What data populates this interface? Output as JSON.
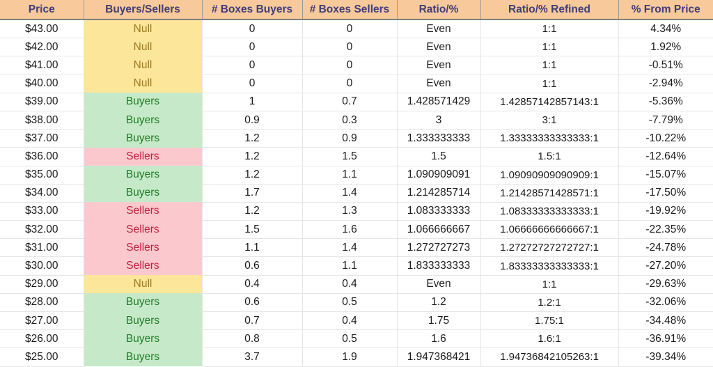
{
  "table": {
    "columns": [
      {
        "key": "price",
        "label": "Price"
      },
      {
        "key": "side",
        "label": "Buyers/Sellers"
      },
      {
        "key": "boxbuy",
        "label": "# Boxes Buyers"
      },
      {
        "key": "boxsell",
        "label": "# Boxes Sellers"
      },
      {
        "key": "ratio",
        "label": "Ratio/%"
      },
      {
        "key": "ratioref",
        "label": "Ratio/% Refined"
      },
      {
        "key": "frompx",
        "label": "% From Price"
      }
    ],
    "colors": {
      "header_bg": "#F8C99A",
      "header_text": "#3F3D7A",
      "null_bg": "#FCE69A",
      "null_text": "#9C7A1E",
      "buyers_bg": "#C6EAC9",
      "buyers_text": "#1E7B24",
      "sellers_bg": "#FBC8CE",
      "sellers_text": "#C0203C",
      "cell_bg": "#FFFFFF",
      "gridline": "#E6E6E6"
    },
    "rows": [
      {
        "price": "$43.00",
        "side": "Null",
        "boxbuy": "0",
        "boxsell": "0",
        "ratio": "Even",
        "ratioref": "1:1",
        "frompx": "4.34%"
      },
      {
        "price": "$42.00",
        "side": "Null",
        "boxbuy": "0",
        "boxsell": "0",
        "ratio": "Even",
        "ratioref": "1:1",
        "frompx": "1.92%"
      },
      {
        "price": "$41.00",
        "side": "Null",
        "boxbuy": "0",
        "boxsell": "0",
        "ratio": "Even",
        "ratioref": "1:1",
        "frompx": "-0.51%"
      },
      {
        "price": "$40.00",
        "side": "Null",
        "boxbuy": "0",
        "boxsell": "0",
        "ratio": "Even",
        "ratioref": "1:1",
        "frompx": "-2.94%"
      },
      {
        "price": "$39.00",
        "side": "Buyers",
        "boxbuy": "1",
        "boxsell": "0.7",
        "ratio": "1.428571429",
        "ratioref": "1.42857142857143:1",
        "frompx": "-5.36%"
      },
      {
        "price": "$38.00",
        "side": "Buyers",
        "boxbuy": "0.9",
        "boxsell": "0.3",
        "ratio": "3",
        "ratioref": "3:1",
        "frompx": "-7.79%"
      },
      {
        "price": "$37.00",
        "side": "Buyers",
        "boxbuy": "1.2",
        "boxsell": "0.9",
        "ratio": "1.333333333",
        "ratioref": "1.33333333333333:1",
        "frompx": "-10.22%"
      },
      {
        "price": "$36.00",
        "side": "Sellers",
        "boxbuy": "1.2",
        "boxsell": "1.5",
        "ratio": "1.5",
        "ratioref": "1.5:1",
        "frompx": "-12.64%"
      },
      {
        "price": "$35.00",
        "side": "Buyers",
        "boxbuy": "1.2",
        "boxsell": "1.1",
        "ratio": "1.090909091",
        "ratioref": "1.09090909090909:1",
        "frompx": "-15.07%"
      },
      {
        "price": "$34.00",
        "side": "Buyers",
        "boxbuy": "1.7",
        "boxsell": "1.4",
        "ratio": "1.214285714",
        "ratioref": "1.21428571428571:1",
        "frompx": "-17.50%"
      },
      {
        "price": "$33.00",
        "side": "Sellers",
        "boxbuy": "1.2",
        "boxsell": "1.3",
        "ratio": "1.083333333",
        "ratioref": "1.08333333333333:1",
        "frompx": "-19.92%"
      },
      {
        "price": "$32.00",
        "side": "Sellers",
        "boxbuy": "1.5",
        "boxsell": "1.6",
        "ratio": "1.066666667",
        "ratioref": "1.06666666666667:1",
        "frompx": "-22.35%"
      },
      {
        "price": "$31.00",
        "side": "Sellers",
        "boxbuy": "1.1",
        "boxsell": "1.4",
        "ratio": "1.272727273",
        "ratioref": "1.27272727272727:1",
        "frompx": "-24.78%"
      },
      {
        "price": "$30.00",
        "side": "Sellers",
        "boxbuy": "0.6",
        "boxsell": "1.1",
        "ratio": "1.833333333",
        "ratioref": "1.83333333333333:1",
        "frompx": "-27.20%"
      },
      {
        "price": "$29.00",
        "side": "Null",
        "boxbuy": "0.4",
        "boxsell": "0.4",
        "ratio": "Even",
        "ratioref": "1:1",
        "frompx": "-29.63%"
      },
      {
        "price": "$28.00",
        "side": "Buyers",
        "boxbuy": "0.6",
        "boxsell": "0.5",
        "ratio": "1.2",
        "ratioref": "1.2:1",
        "frompx": "-32.06%"
      },
      {
        "price": "$27.00",
        "side": "Buyers",
        "boxbuy": "0.7",
        "boxsell": "0.4",
        "ratio": "1.75",
        "ratioref": "1.75:1",
        "frompx": "-34.48%"
      },
      {
        "price": "$26.00",
        "side": "Buyers",
        "boxbuy": "0.8",
        "boxsell": "0.5",
        "ratio": "1.6",
        "ratioref": "1.6:1",
        "frompx": "-36.91%"
      },
      {
        "price": "$25.00",
        "side": "Buyers",
        "boxbuy": "3.7",
        "boxsell": "1.9",
        "ratio": "1.947368421",
        "ratioref": "1.94736842105263:1",
        "frompx": "-39.34%"
      }
    ]
  }
}
